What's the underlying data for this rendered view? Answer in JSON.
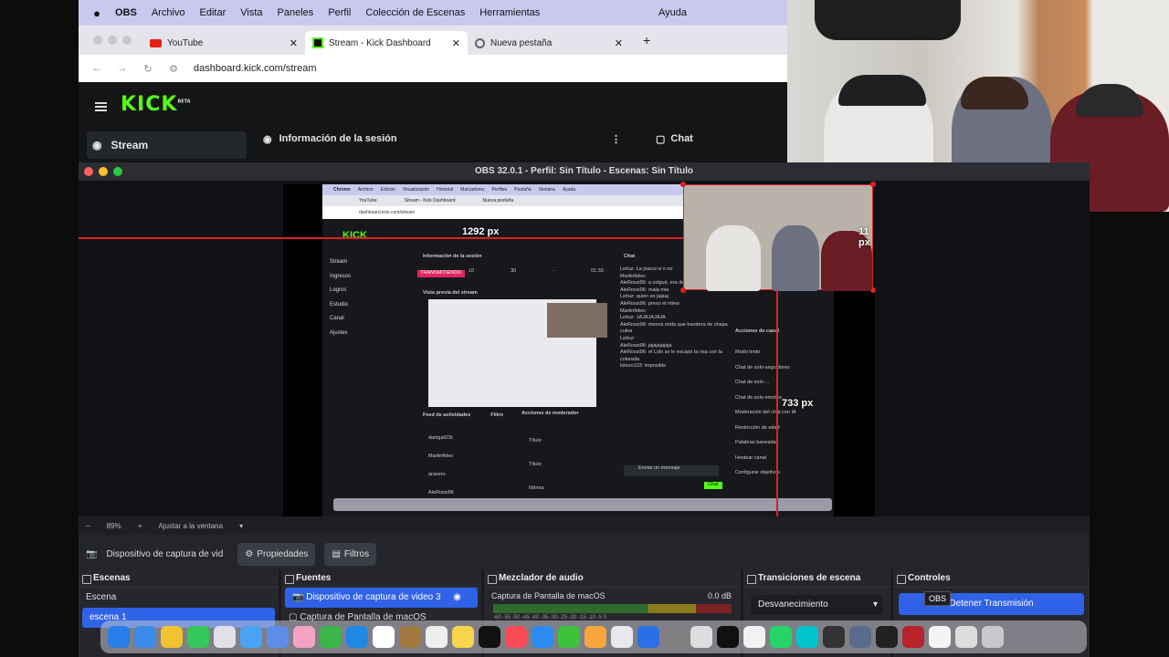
{
  "mac_menu": {
    "items": [
      "OBS",
      "Archivo",
      "Editar",
      "Vista",
      "Paneles",
      "Perfil",
      "Colección de Escenas",
      "Herramientas"
    ],
    "help": "Ayuda"
  },
  "browser": {
    "tabs": [
      {
        "label": "YouTube",
        "icon": "youtube-icon"
      },
      {
        "label": "Stream - Kick Dashboard",
        "icon": "kick-icon",
        "active": true
      },
      {
        "label": "Nueva pestaña",
        "icon": "chrome-icon"
      }
    ],
    "url": "dashboard.kick.com/stream",
    "kick": {
      "logo": "KICK",
      "logo_sup": "BETA",
      "sidebar_stream": "Stream",
      "session_info": "Información de la sesión",
      "chat": "Chat"
    }
  },
  "obs": {
    "title": "OBS 32.0.1 - Perfil: Sin Título - Escenas: Sin Título",
    "measure": {
      "width_label": "1292 px",
      "right_label": "11 px",
      "bottom_label": "733 px"
    },
    "zoom": {
      "minus": "−",
      "value": "89%",
      "plus": "+",
      "fit": "Ajustar a la ventana"
    },
    "source_bar": {
      "source": "Dispositivo de captura de vid",
      "properties": "Propiedades",
      "filters": "Filtros"
    },
    "panels": {
      "scenes": {
        "title": "Escenas",
        "items": [
          "Escena",
          "escena 1"
        ]
      },
      "sources": {
        "title": "Fuentes",
        "items": [
          "Dispositivo de captura de video 3",
          "Captura de Pantalla de macOS"
        ]
      },
      "mixer": {
        "title": "Mezclador de audio",
        "channel": "Captura de Pantalla de macOS",
        "db": "0.0 dB",
        "scale": "-60 -55 -50 -45 -40 -35 -30 -25 -20 -15 -10 -5 0"
      },
      "transitions": {
        "title": "Transiciones de escena",
        "selected": "Desvanecimiento"
      },
      "controls": {
        "title": "Controles",
        "stop": "Detener Transmisión",
        "tooltip": "OBS"
      }
    },
    "inner_capture": {
      "menu": [
        "Chrome",
        "Archivo",
        "Edición",
        "Visualización",
        "Historial",
        "Marcadores",
        "Perfiles",
        "Pestaña",
        "Ventana",
        "Ayuda"
      ],
      "tabs": [
        "YouTube",
        "Stream - Kick Dashboard",
        "Nueva pestaña"
      ],
      "url": "dashboard.kick.com/stream",
      "sidebar": [
        "Stream",
        "Ingresos",
        "Logros",
        "Estudio",
        "Canal",
        "Ajustes"
      ],
      "session": "Información de la sesión",
      "live": "TRANSMITIENDO",
      "stats": [
        "10",
        "30",
        "-",
        "01:33"
      ],
      "preview": "Vista previa del stream",
      "feed_title": "Feed de actividades",
      "feed_filter": "Filtro",
      "feed": [
        "danigali23t",
        "Martinfideo",
        "arasero",
        "AleRossi96"
      ],
      "mod_title": "Acciones de moderador",
      "mod": [
        "Título",
        "Título",
        "Idioma"
      ],
      "chat_title": "Chat",
      "chat": [
        "Leituz: La joacui si o no",
        "Martinfideo:",
        "AleRossi96: a colgué, era de risa",
        "AleRossi96: mala mia",
        "Leituz: quien es jajaaj",
        "AleRossi96: preso el mlew",
        "Martinfideo:",
        "Leituz: JAJAJAJAJA",
        "AleRossi96: menos onda que bandera de chapa culea",
        "Leituz:",
        "AleRossi96: jajajajajaja",
        "AleRossi96: el Lolo se le escapó la risa con la colorada",
        "lolooo123: imposible"
      ],
      "actions_title": "Acciones de canal",
      "actions": [
        "Modo lento",
        "Chat de solo-seguidores",
        "Chat de solo-...",
        "Chat de solo-emotes",
        "Moderación del chat con IA",
        "Restricción de edad",
        "Palabras baneadas",
        "Hostear canal",
        "Configurar objetivos"
      ],
      "chat_placeholder": "Enviar un mensaje",
      "chat_button": "Chat"
    }
  },
  "colors": {
    "kick_green": "#53fc18",
    "obs_blue": "#2f62e6",
    "bbox_red": "#e02020"
  }
}
